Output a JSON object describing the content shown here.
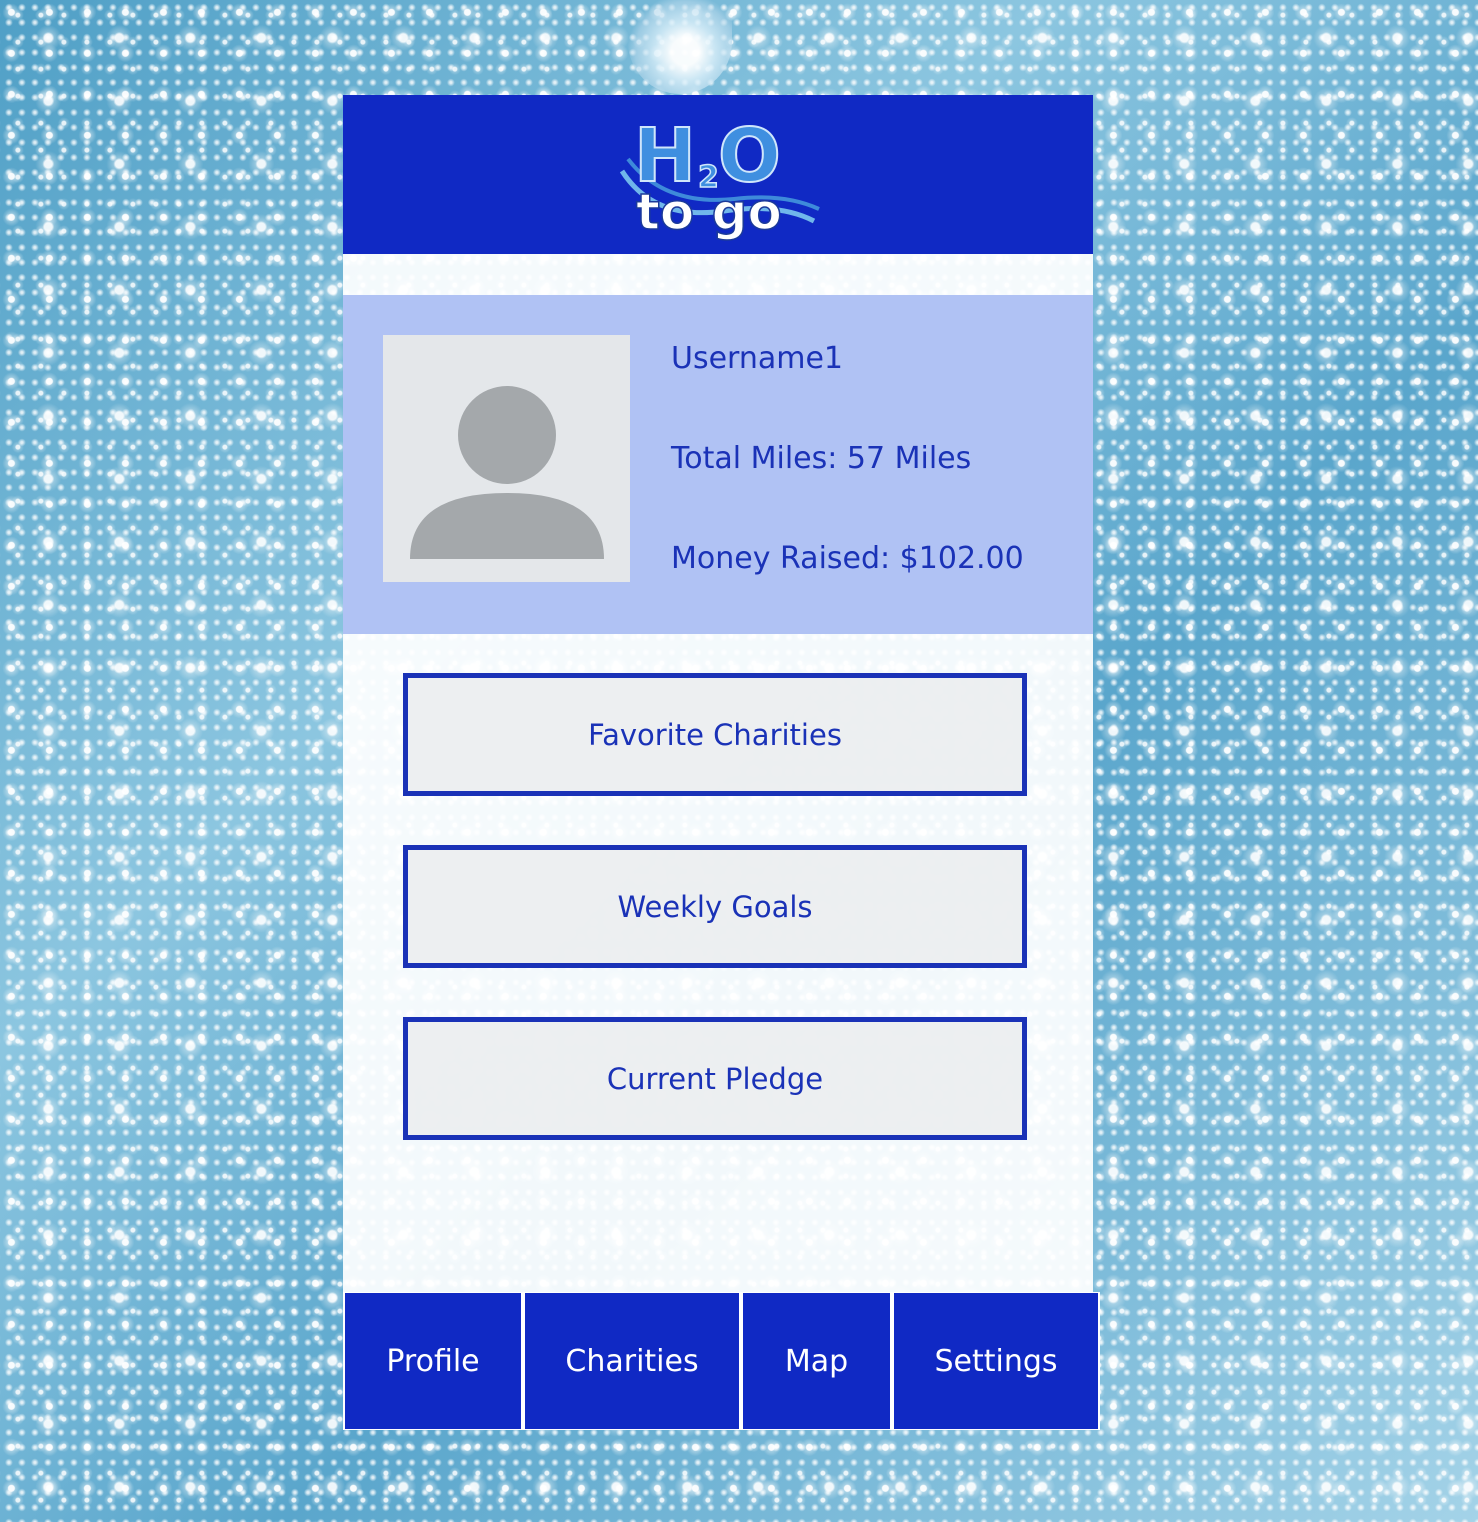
{
  "header": {
    "logo_text_top": "H",
    "logo_text_sub": "2",
    "logo_text_o": "O",
    "logo_text_bottom": "to go",
    "logo_icon": "h2o-to-go-logo"
  },
  "profile": {
    "avatar_icon": "default-user-avatar-icon",
    "username": "Username1",
    "total_miles": "Total Miles: 57 Miles",
    "money_raised": "Money Raised: $102.00"
  },
  "menu": {
    "favorite_charities": "Favorite Charities",
    "weekly_goals": "Weekly Goals",
    "current_pledge": "Current Pledge"
  },
  "tabs": {
    "profile": "Profile",
    "charities": "Charities",
    "map": "Map",
    "settings": "Settings"
  },
  "colors": {
    "brand_blue": "#1029c4",
    "text_blue": "#1a32b7",
    "profile_band": "#b0c2f4",
    "background": "#6fb0cf"
  }
}
